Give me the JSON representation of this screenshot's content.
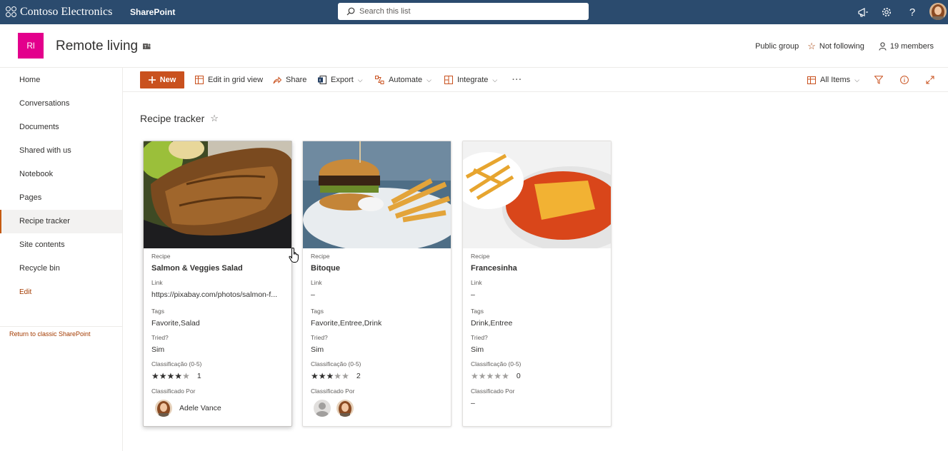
{
  "suite": {
    "brand": "Contoso Electronics",
    "app": "SharePoint",
    "search_placeholder": "Search this list"
  },
  "site": {
    "logo_text": "Rl",
    "title": "Remote living",
    "public_group": "Public group",
    "following": "Not following",
    "members": "19 members"
  },
  "nav": {
    "items": [
      {
        "label": "Home"
      },
      {
        "label": "Conversations"
      },
      {
        "label": "Documents"
      },
      {
        "label": "Shared with us"
      },
      {
        "label": "Notebook"
      },
      {
        "label": "Pages"
      },
      {
        "label": "Recipe tracker"
      },
      {
        "label": "Site contents"
      },
      {
        "label": "Recycle bin"
      }
    ],
    "edit": "Edit",
    "classic": "Return to classic SharePoint"
  },
  "commands": {
    "new": "New",
    "grid": "Edit in grid view",
    "share": "Share",
    "export": "Export",
    "automate": "Automate",
    "integrate": "Integrate",
    "more": "···",
    "view": "All Items"
  },
  "list": {
    "title": "Recipe tracker"
  },
  "labels": {
    "recipe": "Recipe",
    "link": "Link",
    "tags": "Tags",
    "tried": "Tried?",
    "rating": "Classificação (0-5)",
    "rated_by": "Classificado Por"
  },
  "cards": [
    {
      "recipe": "Salmon & Veggies Salad",
      "link": "https://pixabay.com/photos/salmon-f...",
      "tags": "Favorite,Salad",
      "tried": "Sim",
      "rating": 4,
      "rating_count": "1",
      "rated_by_name": "Adele Vance"
    },
    {
      "recipe": "Bitoque",
      "link": "–",
      "tags": "Favorite,Entree,Drink",
      "tried": "Sim",
      "rating": 3,
      "rating_count": "2"
    },
    {
      "recipe": "Francesinha",
      "link": "–",
      "tags": "Drink,Entree",
      "tried": "Sim",
      "rating": 0,
      "rating_count": "0",
      "rated_by_empty": "–"
    }
  ],
  "colors": {
    "suitebar": "#2b4b6e",
    "accent": "#c9511e",
    "site_logo": "#e3008c"
  }
}
